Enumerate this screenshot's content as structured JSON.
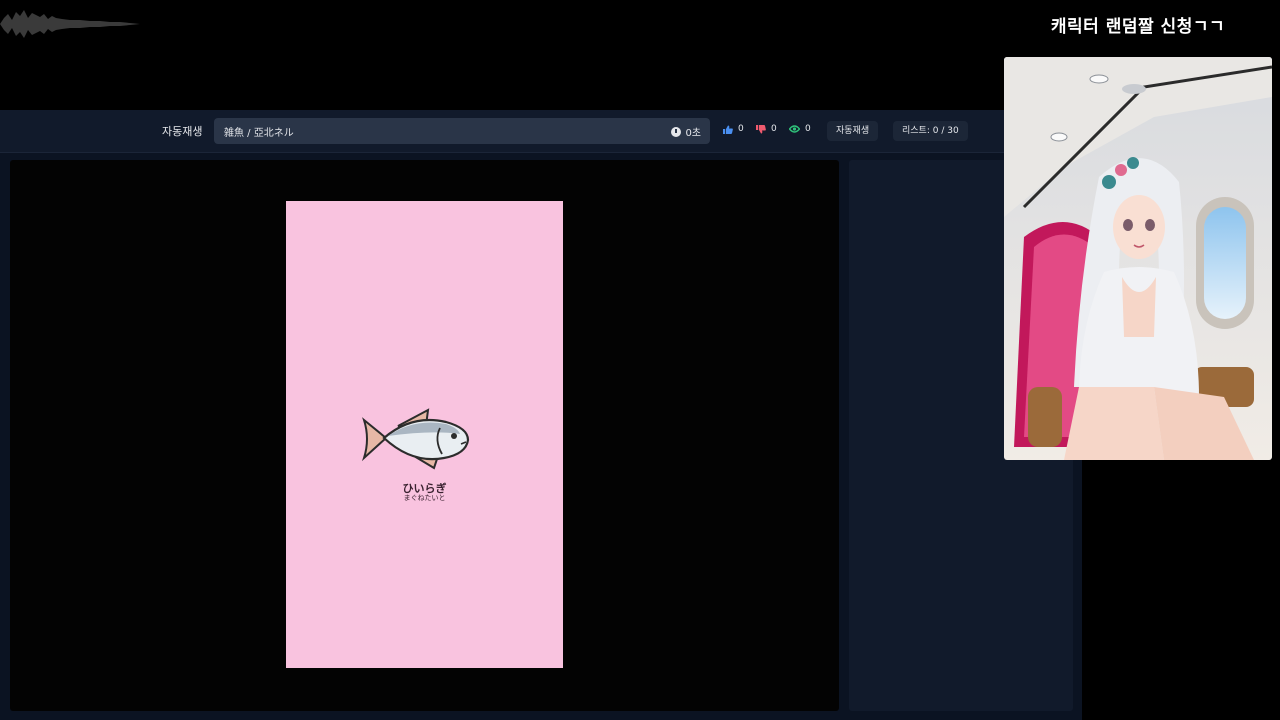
{
  "overlay": {
    "title": "캐릭터 랜덤짤 신청ㄱㄱ"
  },
  "toolbar": {
    "autoplay_label": "자동재생",
    "track_title": "雑魚 / 亞北ネル",
    "elapsed": "0초",
    "likes": "0",
    "dislikes": "0",
    "views": "0",
    "autoplay_button": "자동재생",
    "list_status": "리스트: 0 / 30"
  },
  "poster": {
    "fish_name": "ひいらぎ",
    "fish_reading": "まぐねたいと"
  },
  "colors": {
    "poster_bg": "#f9c3df",
    "like": "#4a8ff0",
    "dislike": "#f05a6e",
    "views": "#2fc27a"
  },
  "icons": {
    "clock": "clock-icon",
    "like": "thumbs-up-icon",
    "dislike": "thumbs-down-icon",
    "views": "eye-icon"
  }
}
